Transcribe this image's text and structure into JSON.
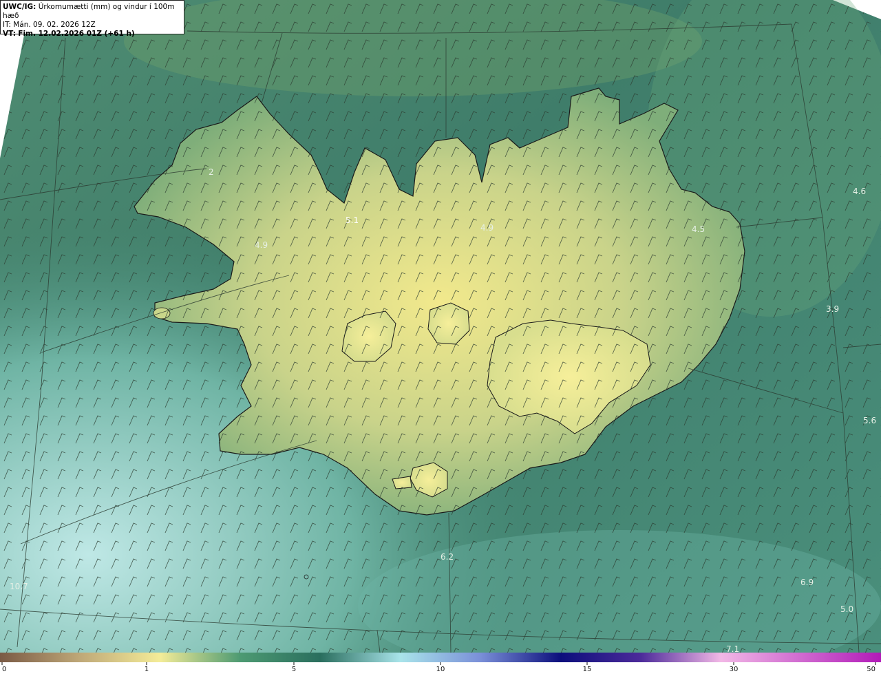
{
  "header": {
    "model_label": "UWC/IG:",
    "title": "Úrkomumætti (mm) og vindur í 100m hæð",
    "it_line": "IT: Mán. 09. 02. 2026 12Z",
    "vt_label": "VT:",
    "vt_value": "Fim. 12.02.2026 01Z (+61 h)"
  },
  "map_values": [
    {
      "id": "v1",
      "text": "2",
      "loc": "westfjords"
    },
    {
      "id": "v2",
      "text": "5.1",
      "loc": "north-west"
    },
    {
      "id": "v3",
      "text": "4.9",
      "loc": "west-fjord-south"
    },
    {
      "id": "v4",
      "text": "4.9",
      "loc": "north-central"
    },
    {
      "id": "v5",
      "text": "4.5",
      "loc": "east"
    },
    {
      "id": "v6",
      "text": "4.6",
      "loc": "far-east-sea"
    },
    {
      "id": "v7",
      "text": "3.9",
      "loc": "east-sea"
    },
    {
      "id": "v8",
      "text": "5.6",
      "loc": "south-east-sea"
    },
    {
      "id": "v9",
      "text": "6.2",
      "loc": "south-sea"
    },
    {
      "id": "v10",
      "text": "6.9",
      "loc": "south-east-sea-2"
    },
    {
      "id": "v11",
      "text": "5.0",
      "loc": "south-east-sea-3"
    },
    {
      "id": "v12",
      "text": "10.7",
      "loc": "south-west-sea"
    },
    {
      "id": "v13",
      "text": "7.1",
      "loc": "bottom-sea"
    }
  ],
  "colorbar": {
    "ticks": [
      "0",
      "1",
      "5",
      "10",
      "15",
      "30",
      "50"
    ],
    "stops": [
      "#7a5a45",
      "#bfa878",
      "#f4ec98",
      "#4d9a72",
      "#2a6e5e",
      "#a9e4ea",
      "#7a8fd8",
      "#0c0f7c",
      "#4c2a9a",
      "#f2b8e6",
      "#d06ad0",
      "#b21ab8"
    ]
  }
}
